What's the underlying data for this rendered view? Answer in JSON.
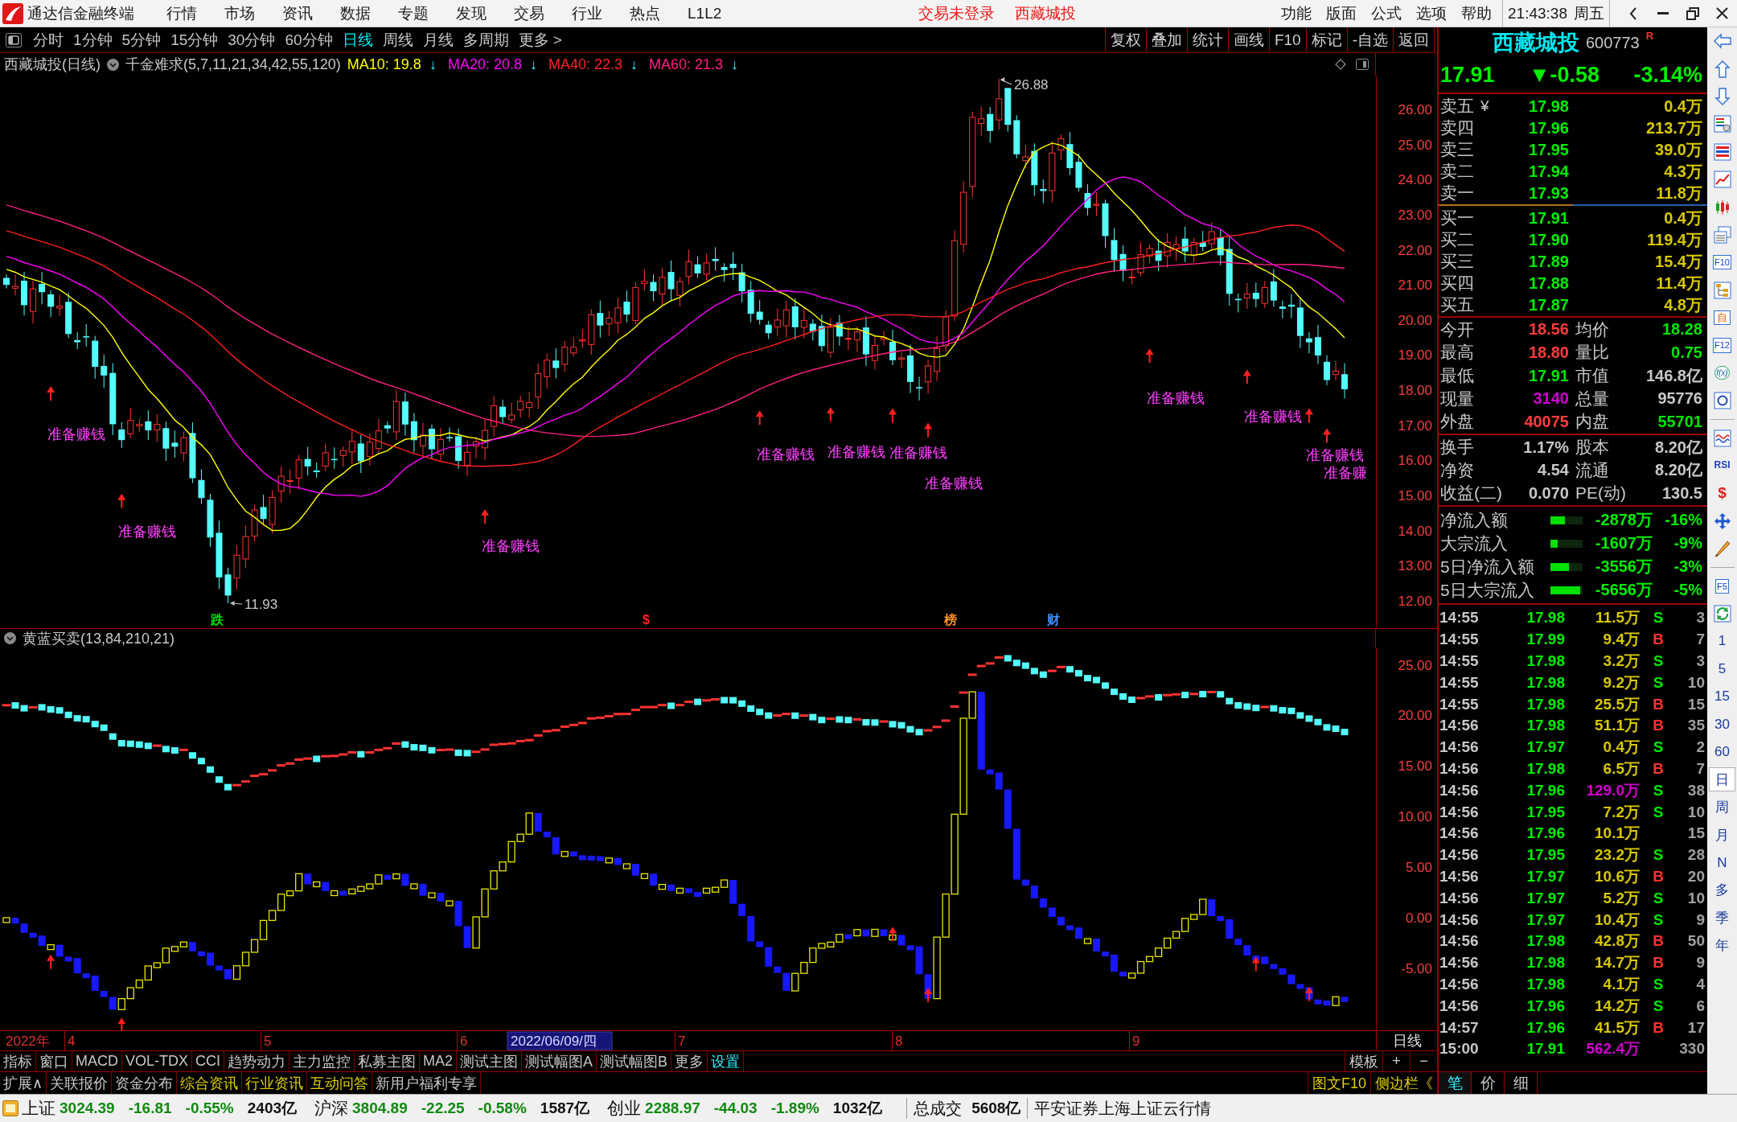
{
  "title_bar": {
    "app_name": "通达信金融终端",
    "menus": [
      "行情",
      "市场",
      "资讯",
      "数据",
      "专题",
      "发现",
      "交易",
      "行业",
      "热点",
      "L1L2"
    ],
    "notices": [
      "交易未登录",
      "西藏城投"
    ],
    "right_menus": [
      "功能",
      "版面",
      "公式",
      "选项",
      "帮助"
    ],
    "clock": "21:43:38",
    "weekday": "周五"
  },
  "period_bar": {
    "tabs": [
      {
        "label": "分时",
        "selected": false
      },
      {
        "label": "1分钟",
        "selected": false
      },
      {
        "label": "5分钟",
        "selected": false
      },
      {
        "label": "15分钟",
        "selected": false
      },
      {
        "label": "30分钟",
        "selected": false
      },
      {
        "label": "60分钟",
        "selected": false
      },
      {
        "label": "日线",
        "selected": true
      },
      {
        "label": "周线",
        "selected": false
      },
      {
        "label": "月线",
        "selected": false
      },
      {
        "label": "多周期",
        "selected": false
      },
      {
        "label": "更多 >",
        "selected": false
      }
    ],
    "tools": [
      "复权",
      "叠加",
      "统计",
      "画线",
      "F10",
      "标记",
      "-自选",
      "返回"
    ]
  },
  "main_chart": {
    "stock": "西藏城投(日线)",
    "indicator": "千金难求(5,7,11,21,34,42,55,120)",
    "ma_legend": [
      {
        "label": "MA10: 19.8",
        "trend": "↓",
        "color": "#ffff00"
      },
      {
        "label": "MA20: 20.8",
        "trend": "↓",
        "color": "#ff00ff"
      },
      {
        "label": "MA40: 22.3",
        "trend": "↓",
        "color": "#ff2020"
      },
      {
        "label": "MA60: 21.3",
        "trend": "↓",
        "color": "#ff2080"
      }
    ],
    "price_axis": [
      "26.00",
      "25.00",
      "24.00",
      "23.00",
      "22.00",
      "21.00",
      "20.00",
      "19.00",
      "18.00",
      "17.00",
      "16.00",
      "15.00",
      "14.00",
      "13.00",
      "12.00"
    ],
    "high_label": "26.88",
    "low_label": "11.93",
    "signals": [
      {
        "label": "准备赚钱"
      },
      {
        "label": "准备赚钱"
      },
      {
        "label": "准备赚钱"
      },
      {
        "label": "准备赚钱"
      },
      {
        "label": "准备赚钱"
      },
      {
        "label": "准备赚钱"
      },
      {
        "label": "准备赚钱"
      },
      {
        "label": "准备赚钱"
      },
      {
        "label": "准备赚钱"
      },
      {
        "label": "准备赚钱"
      },
      {
        "label": "准备赚"
      }
    ],
    "event_marks": [
      {
        "label": "跌",
        "color": "#00e000"
      },
      {
        "label": "$",
        "color": "#ff2020"
      },
      {
        "label": "榜",
        "color": "#ff9020"
      },
      {
        "label": "财",
        "color": "#4090ff"
      }
    ]
  },
  "sub_chart": {
    "title": "黄蓝买卖(13,84,210,21)",
    "axis": [
      "25.00",
      "20.00",
      "15.00",
      "10.00",
      "5.00",
      "0.00",
      "-5.00"
    ]
  },
  "date_axis": {
    "labels": [
      {
        "label": "2022年",
        "kind": "year"
      },
      {
        "label": "4",
        "kind": "month"
      },
      {
        "label": "5",
        "kind": "month"
      },
      {
        "label": "6",
        "kind": "month"
      },
      {
        "label": "2022/06/09/四",
        "kind": "cursor"
      },
      {
        "label": "7",
        "kind": "month"
      },
      {
        "label": "8",
        "kind": "month"
      },
      {
        "label": "9",
        "kind": "month"
      }
    ],
    "period": "日线"
  },
  "indicator_tabs": {
    "tabs": [
      {
        "label": "指标",
        "kind": "plain"
      },
      {
        "label": "窗口",
        "kind": "plain"
      },
      {
        "label": "MACD",
        "kind": "plain"
      },
      {
        "label": "VOL-TDX",
        "kind": "plain"
      },
      {
        "label": "CCI",
        "kind": "plain"
      },
      {
        "label": "趋势动力",
        "kind": "plain"
      },
      {
        "label": "主力监控",
        "kind": "plain"
      },
      {
        "label": "私募主图",
        "kind": "plain"
      },
      {
        "label": "MA2",
        "kind": "plain"
      },
      {
        "label": "测试主图",
        "kind": "plain"
      },
      {
        "label": "测试幅图A",
        "kind": "plain"
      },
      {
        "label": "测试幅图B",
        "kind": "plain"
      },
      {
        "label": "更多",
        "kind": "plain"
      },
      {
        "label": "设置",
        "kind": "accent"
      }
    ],
    "controls": [
      "模板",
      "+",
      "−"
    ]
  },
  "extension_tabs": {
    "tabs": [
      {
        "label": "扩展∧",
        "kind": "plain"
      },
      {
        "label": "关联报价",
        "kind": "plain"
      },
      {
        "label": "资金分布",
        "kind": "plain"
      },
      {
        "label": "综合资讯",
        "kind": "info"
      },
      {
        "label": "行业资讯",
        "kind": "info"
      },
      {
        "label": "互动问答",
        "kind": "info"
      },
      {
        "label": "新用户福利专享",
        "kind": "plain"
      }
    ],
    "side_links": [
      "图文F10",
      "侧边栏《"
    ]
  },
  "quote": {
    "name": "西藏城投",
    "code": "600773",
    "flag": "R",
    "price": "17.91",
    "change": "▼-0.58",
    "change_pct": "-3.14%"
  },
  "order_book": {
    "asks": [
      {
        "label": "卖五",
        "tag": "¥",
        "price": "17.98",
        "volume": "0.4万"
      },
      {
        "label": "卖四",
        "price": "17.96",
        "volume": "213.7万"
      },
      {
        "label": "卖三",
        "price": "17.95",
        "volume": "39.0万"
      },
      {
        "label": "卖二",
        "price": "17.94",
        "volume": "4.3万"
      },
      {
        "label": "卖一",
        "price": "17.93",
        "volume": "11.8万"
      }
    ],
    "bids": [
      {
        "label": "买一",
        "price": "17.91",
        "volume": "0.4万"
      },
      {
        "label": "买二",
        "price": "17.90",
        "volume": "119.4万"
      },
      {
        "label": "买三",
        "price": "17.89",
        "volume": "15.4万"
      },
      {
        "label": "买四",
        "price": "17.88",
        "volume": "11.4万"
      },
      {
        "label": "买五",
        "price": "17.87",
        "volume": "4.8万"
      }
    ]
  },
  "stats": [
    {
      "label": "今开",
      "value": "18.56",
      "kind": "up"
    },
    {
      "label": "均价",
      "value": "18.28",
      "kind": "down"
    },
    {
      "label": "最高",
      "value": "18.80",
      "kind": "up"
    },
    {
      "label": "量比",
      "value": "0.75",
      "kind": "down"
    },
    {
      "label": "最低",
      "value": "17.91",
      "kind": "down"
    },
    {
      "label": "市值",
      "value": "146.8亿",
      "kind": "flat"
    },
    {
      "label": "现量",
      "value": "3140",
      "kind": "volume"
    },
    {
      "label": "总量",
      "value": "95776",
      "kind": "flat"
    },
    {
      "label": "外盘",
      "value": "40075",
      "kind": "up"
    },
    {
      "label": "内盘",
      "value": "55701",
      "kind": "down"
    }
  ],
  "fundamentals": [
    {
      "label": "换手",
      "value": "1.17%"
    },
    {
      "label": "股本",
      "value": "8.20亿"
    },
    {
      "label": "净资",
      "value": "4.54"
    },
    {
      "label": "流通",
      "value": "8.20亿"
    },
    {
      "label": "收益(二)",
      "value": "0.070"
    },
    {
      "label": "PE(动)",
      "value": "130.5"
    }
  ],
  "funds_flow": [
    {
      "label": "净流入额",
      "level": 0.45,
      "amount": "-2878万",
      "pct": "-16%"
    },
    {
      "label": "大宗流入",
      "level": 0.22,
      "amount": "-1607万",
      "pct": "-9%"
    },
    {
      "label": "5日净流入额",
      "level": 0.57,
      "amount": "-3556万",
      "pct": "-3%"
    },
    {
      "label": "5日大宗流入",
      "level": 0.92,
      "amount": "-5656万",
      "pct": "-5%"
    }
  ],
  "ticks": [
    {
      "time": "14:55",
      "price": "17.98",
      "volume": "11.5万",
      "large": false,
      "kind": "sell",
      "side": "S",
      "count": "3"
    },
    {
      "time": "14:55",
      "price": "17.99",
      "volume": "9.4万",
      "large": false,
      "kind": "buy",
      "side": "B",
      "count": "7"
    },
    {
      "time": "14:55",
      "price": "17.98",
      "volume": "3.2万",
      "large": false,
      "kind": "sell",
      "side": "S",
      "count": "3"
    },
    {
      "time": "14:55",
      "price": "17.98",
      "volume": "9.2万",
      "large": false,
      "kind": "sell",
      "side": "S",
      "count": "10"
    },
    {
      "time": "14:55",
      "price": "17.98",
      "volume": "25.5万",
      "large": false,
      "kind": "buy",
      "side": "B",
      "count": "15"
    },
    {
      "time": "14:56",
      "price": "17.98",
      "volume": "51.1万",
      "large": false,
      "kind": "buy",
      "side": "B",
      "count": "35"
    },
    {
      "time": "14:56",
      "price": "17.97",
      "volume": "0.4万",
      "large": false,
      "kind": "sell",
      "side": "S",
      "count": "2"
    },
    {
      "time": "14:56",
      "price": "17.98",
      "volume": "6.5万",
      "large": false,
      "kind": "buy",
      "side": "B",
      "count": "7"
    },
    {
      "time": "14:56",
      "price": "17.96",
      "volume": "129.0万",
      "large": true,
      "kind": "sell",
      "side": "S",
      "count": "38"
    },
    {
      "time": "14:56",
      "price": "17.95",
      "volume": "7.2万",
      "large": false,
      "kind": "sell",
      "side": "S",
      "count": "10"
    },
    {
      "time": "14:56",
      "price": "17.96",
      "volume": "10.1万",
      "large": false,
      "kind": "none",
      "count": "15"
    },
    {
      "time": "14:56",
      "price": "17.95",
      "volume": "23.2万",
      "large": false,
      "kind": "sell",
      "side": "S",
      "count": "28"
    },
    {
      "time": "14:56",
      "price": "17.97",
      "volume": "10.6万",
      "large": false,
      "kind": "buy",
      "side": "B",
      "count": "20"
    },
    {
      "time": "14:56",
      "price": "17.97",
      "volume": "5.2万",
      "large": false,
      "kind": "sell",
      "side": "S",
      "count": "10"
    },
    {
      "time": "14:56",
      "price": "17.97",
      "volume": "10.4万",
      "large": false,
      "kind": "sell",
      "side": "S",
      "count": "9"
    },
    {
      "time": "14:56",
      "price": "17.98",
      "volume": "42.8万",
      "large": false,
      "kind": "buy",
      "side": "B",
      "count": "50"
    },
    {
      "time": "14:56",
      "price": "17.98",
      "volume": "14.7万",
      "large": false,
      "kind": "buy",
      "side": "B",
      "count": "9"
    },
    {
      "time": "14:56",
      "price": "17.98",
      "volume": "4.1万",
      "large": false,
      "kind": "sell",
      "side": "S",
      "count": "4"
    },
    {
      "time": "14:56",
      "price": "17.96",
      "volume": "14.2万",
      "large": false,
      "kind": "sell",
      "side": "S",
      "count": "6"
    },
    {
      "time": "14:57",
      "price": "17.96",
      "volume": "41.5万",
      "large": false,
      "kind": "buy",
      "side": "B",
      "count": "17"
    },
    {
      "time": "15:00",
      "price": "17.91",
      "volume": "562.4万",
      "large": true,
      "kind": "none",
      "count": "330"
    }
  ],
  "detail_tabs": [
    {
      "label": "笔",
      "selected": true
    },
    {
      "label": "价",
      "selected": false
    },
    {
      "label": "细",
      "selected": false
    }
  ],
  "side_strip": {
    "tool_labels": [
      "F10",
      "自",
      "F12",
      "f(x)",
      "RSI",
      "$",
      "F5"
    ],
    "periods": [
      {
        "label": "1",
        "selected": false
      },
      {
        "label": "5",
        "selected": false
      },
      {
        "label": "15",
        "selected": false
      },
      {
        "label": "30",
        "selected": false
      },
      {
        "label": "60",
        "selected": false
      },
      {
        "label": "日",
        "selected": true
      },
      {
        "label": "周",
        "selected": false
      },
      {
        "label": "月",
        "selected": false
      },
      {
        "label": "N",
        "selected": false
      },
      {
        "label": "多",
        "selected": false
      },
      {
        "label": "季",
        "selected": false
      },
      {
        "label": "年",
        "selected": false
      }
    ]
  },
  "status_bar": {
    "indices": [
      {
        "name": "上证",
        "value": "3024.39",
        "change": "-16.81",
        "pct": "-0.55%",
        "amount": "2403亿"
      },
      {
        "name": "沪深",
        "value": "3804.89",
        "change": "-22.25",
        "pct": "-0.58%",
        "amount": "1587亿"
      },
      {
        "name": "创业",
        "value": "2288.97",
        "change": "-44.03",
        "pct": "-1.89%",
        "amount": "1032亿"
      }
    ],
    "total_label": "总成交",
    "total": "5608亿",
    "source": "平安证券上海上证云行情"
  }
}
